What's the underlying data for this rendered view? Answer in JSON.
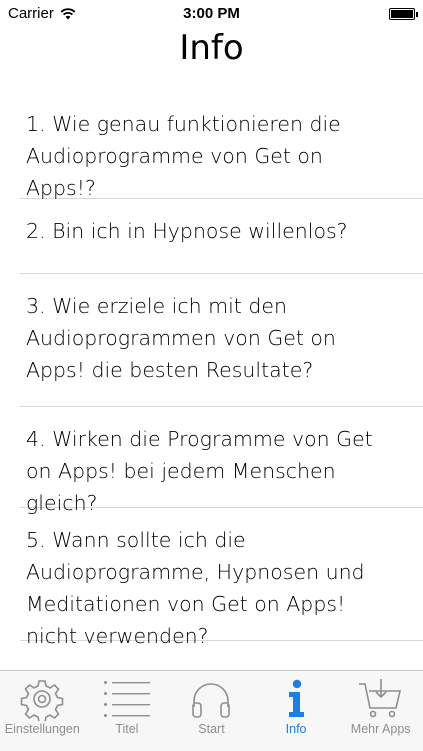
{
  "status_bar": {
    "carrier": "Carrier",
    "time": "3:00 PM"
  },
  "header": {
    "title": "Info"
  },
  "faq": {
    "items": [
      {
        "label": "1. Wie genau funktionieren die Audioprogramme von Get on Apps!?"
      },
      {
        "label": "2. Bin ich in Hypnose willenlos?"
      },
      {
        "label": "3. Wie erziele ich mit den Audioprogrammen von Get on Apps! die besten Resultate?"
      },
      {
        "label": "4. Wirken die Programme von Get on Apps! bei jedem Menschen gleich?"
      },
      {
        "label": "5. Wann sollte ich die Audioprogramme, Hypnosen und Meditationen von Get on Apps! nicht verwenden?"
      }
    ]
  },
  "tab_bar": {
    "tabs": [
      {
        "label": "Einstellungen",
        "icon": "gear-icon"
      },
      {
        "label": "Titel",
        "icon": "list-icon"
      },
      {
        "label": "Start",
        "icon": "headphones-icon"
      },
      {
        "label": "Info",
        "icon": "info-icon"
      },
      {
        "label": "Mehr Apps",
        "icon": "cart-icon"
      }
    ],
    "active_index": 3,
    "active_color": "#1a7fe6",
    "inactive_color": "#8e8e8e"
  }
}
